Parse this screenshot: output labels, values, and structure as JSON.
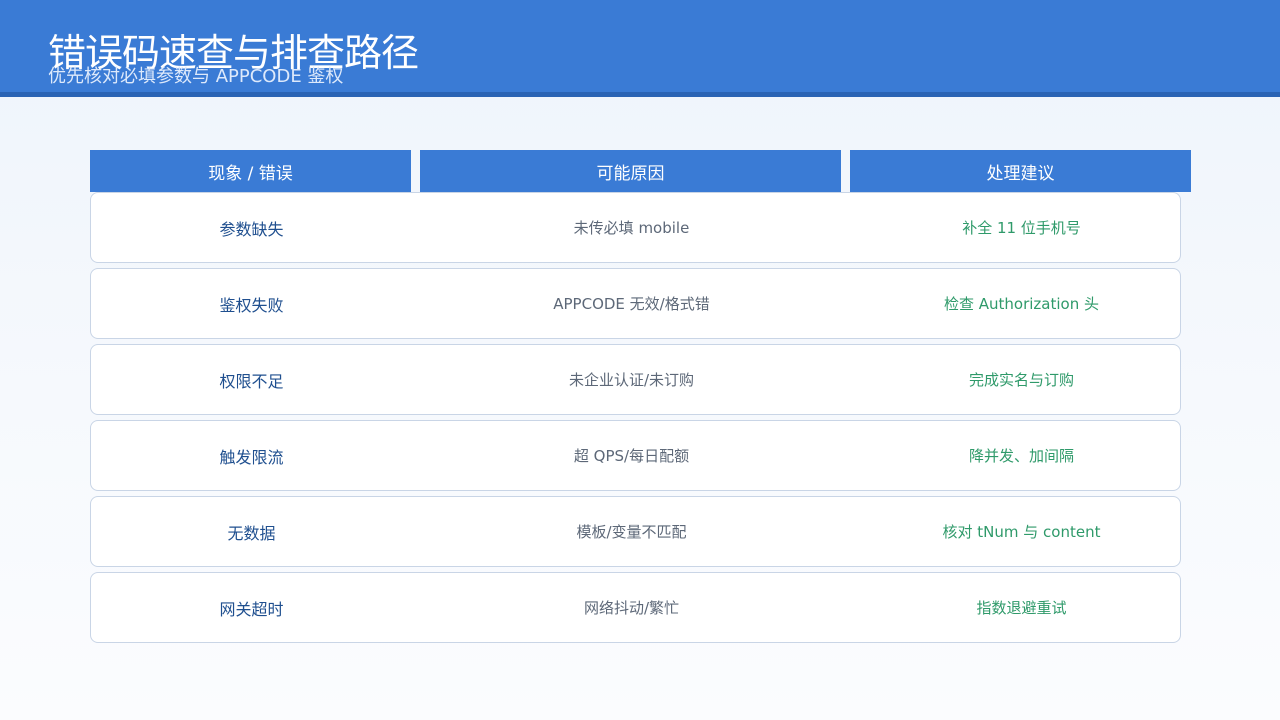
{
  "header": {
    "title": "错误码速查与排查路径",
    "subtitle": "优先核对必填参数与 APPCODE 鉴权"
  },
  "table": {
    "columns": [
      "现象 / 错误",
      "可能原因",
      "处理建议"
    ],
    "rows": [
      {
        "symptom": "参数缺失",
        "cause": "未传必填 mobile",
        "advice": "补全 11 位手机号"
      },
      {
        "symptom": "鉴权失败",
        "cause": "APPCODE 无效/格式错",
        "advice": "检查 Authorization 头"
      },
      {
        "symptom": "权限不足",
        "cause": "未企业认证/未订购",
        "advice": "完成实名与订购"
      },
      {
        "symptom": "触发限流",
        "cause": "超 QPS/每日配额",
        "advice": "降并发、加间隔"
      },
      {
        "symptom": "无数据",
        "cause": "模板/变量不匹配",
        "advice": "核对 tNum 与 content"
      },
      {
        "symptom": "网关超时",
        "cause": "网络抖动/繁忙",
        "advice": "指数退避重试"
      }
    ]
  },
  "colors": {
    "header": "#3a7bd5",
    "header_border": "#2a63b4",
    "symptom_text": "#1f4f8f",
    "cause_text": "#5d6878",
    "advice_text": "#2f9a6a"
  }
}
